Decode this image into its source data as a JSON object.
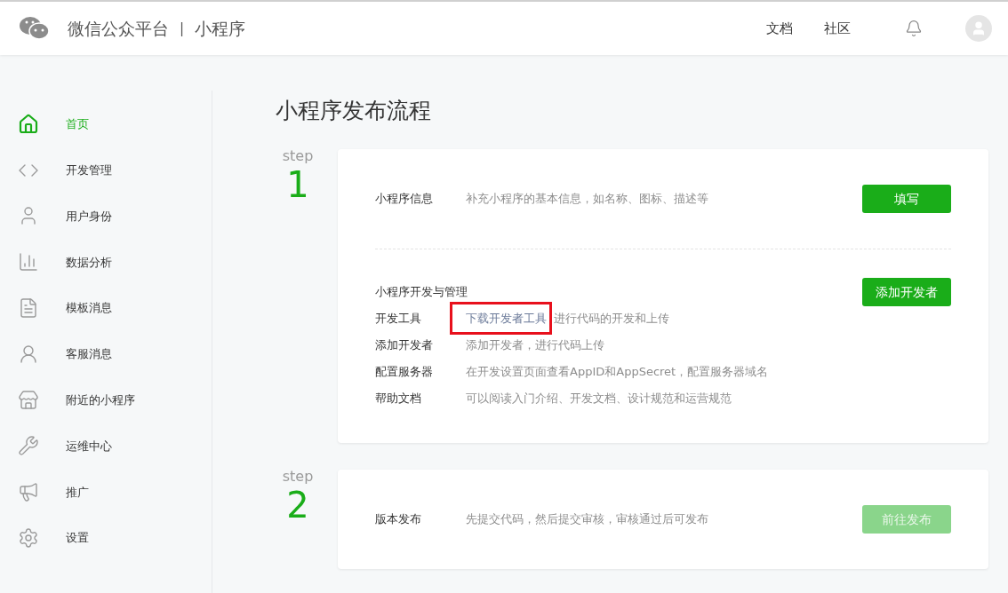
{
  "header": {
    "brand": "微信公众平台",
    "separator": "|",
    "product": "小程序",
    "links": [
      "文档",
      "社区"
    ]
  },
  "sidebar": {
    "items": [
      {
        "label": "首页",
        "selected": true
      },
      {
        "label": "开发管理",
        "selected": false
      },
      {
        "label": "用户身份",
        "selected": false
      },
      {
        "label": "数据分析",
        "selected": false
      },
      {
        "label": "模板消息",
        "selected": false
      },
      {
        "label": "客服消息",
        "selected": false
      },
      {
        "label": "附近的小程序",
        "selected": false
      },
      {
        "label": "运维中心",
        "selected": false
      },
      {
        "label": "推广",
        "selected": false
      },
      {
        "label": "设置",
        "selected": false
      }
    ]
  },
  "page_title": "小程序发布流程",
  "steps": [
    {
      "word": "step",
      "number": "1",
      "sections": [
        {
          "kind": "single",
          "label": "小程序信息",
          "description": "补充小程序的基本信息，如名称、图标、描述等",
          "button": {
            "label": "填写",
            "disabled": false
          }
        },
        {
          "kind": "list",
          "heading": "小程序开发与管理",
          "button": {
            "label": "添加开发者",
            "disabled": false
          },
          "rows": [
            {
              "label": "开发工具",
              "lead": "下载开发者工具",
              "description": "进行代码的开发和上传",
              "highlighted": true
            },
            {
              "label": "添加开发者",
              "description": "添加开发者，进行代码上传",
              "highlighted": false
            },
            {
              "label": "配置服务器",
              "description": "在开发设置页面查看AppID和AppSecret，配置服务器域名",
              "highlighted": false
            },
            {
              "label": "帮助文档",
              "description": "可以阅读入门介绍、开发文档、设计规范和运营规范",
              "highlighted": false
            }
          ]
        }
      ]
    },
    {
      "word": "step",
      "number": "2",
      "sections": [
        {
          "kind": "single",
          "label": "版本发布",
          "description": "先提交代码，然后提交审核，审核通过后可发布",
          "button": {
            "label": "前往发布",
            "disabled": true
          }
        }
      ]
    }
  ]
}
